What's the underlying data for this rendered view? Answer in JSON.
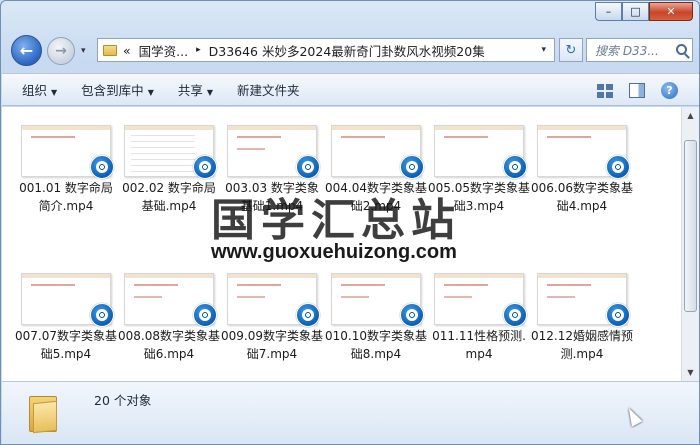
{
  "window": {
    "caption": {
      "minimize": "–",
      "maximize": "□",
      "close": "✕"
    }
  },
  "nav": {
    "back_glyph": "←",
    "forward_glyph": "→",
    "history_glyph": "▾",
    "address": {
      "crumbs": [
        "«",
        "国学资...",
        "▸",
        "D33646 米妙多2024最新奇门卦数风水视频20集"
      ],
      "dropdown_glyph": "▾"
    },
    "refresh_glyph": "↻",
    "search_placeholder": "搜索 D33..."
  },
  "toolbar": {
    "organize": "组织",
    "include_library": "包含到库中",
    "share": "共享",
    "new_folder": "新建文件夹",
    "caret": "▼",
    "help_glyph": "?"
  },
  "files": [
    {
      "name": "001.01 数字命局简介.mp4",
      "thumb": "blank"
    },
    {
      "name": "002.02 数字命局基础.mp4",
      "thumb": "grid"
    },
    {
      "name": "003.03 数字类象基础1.mp4",
      "thumb": "scribble"
    },
    {
      "name": "004.04数字类象基础2.mp4",
      "thumb": "blank"
    },
    {
      "name": "005.05数字类象基础3.mp4",
      "thumb": "blank"
    },
    {
      "name": "006.06数字类象基础4.mp4",
      "thumb": "blank"
    },
    {
      "name": "007.07数字类象基础5.mp4",
      "thumb": "blank"
    },
    {
      "name": "008.08数字类象基础6.mp4",
      "thumb": "scribble"
    },
    {
      "name": "009.09数字类象基础7.mp4",
      "thumb": "scribble"
    },
    {
      "name": "010.10数字类象基础8.mp4",
      "thumb": "scribble"
    },
    {
      "name": "011.11性格预测.mp4",
      "thumb": "scribble"
    },
    {
      "name": "012.12婚姻感情预测.mp4",
      "thumb": "scribble"
    }
  ],
  "watermark": {
    "cn": "国学汇总站",
    "url": "www.guoxuehuizong.com"
  },
  "status": {
    "count": "20 个对象"
  },
  "scrollbar": {
    "up": "▲",
    "down": "▼"
  }
}
